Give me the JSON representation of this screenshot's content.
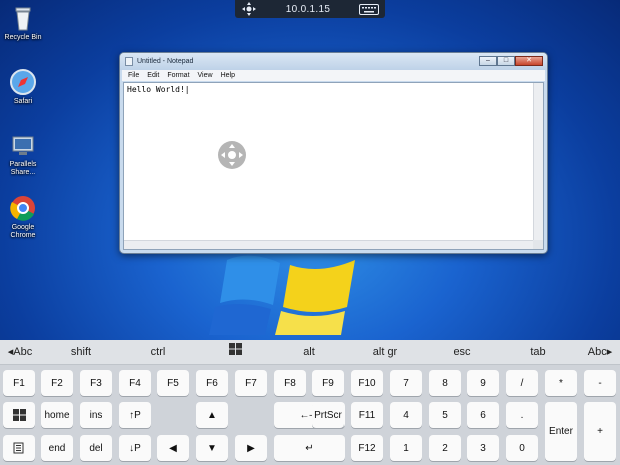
{
  "remote_bar": {
    "address": "10.0.1.15"
  },
  "desktop_icons": [
    {
      "label": "Recycle Bin",
      "icon": "recycle-bin-icon"
    },
    {
      "label": "Safari",
      "icon": "safari-icon"
    },
    {
      "label": "Parallels Share...",
      "icon": "parallels-share-icon"
    },
    {
      "label": "Google Chrome",
      "icon": "chrome-icon"
    }
  ],
  "notepad": {
    "title": "Untitled - Notepad",
    "menu": [
      "File",
      "Edit",
      "Format",
      "View",
      "Help"
    ],
    "content": "Hello World!|"
  },
  "keyboard": {
    "modifiers": [
      "◂Abc",
      "shift",
      "ctrl",
      "win",
      "alt",
      "alt gr",
      "esc",
      "tab",
      "Abc▸"
    ],
    "row1": [
      "F1",
      "F2",
      "F3",
      "F4",
      "F5",
      "F6",
      "F7",
      "F8",
      "F9",
      "F10",
      "7",
      "8",
      "9",
      "/",
      "*",
      "-"
    ],
    "row2": [
      "win",
      "home",
      "ins",
      "↑P",
      "▲",
      "←—",
      "PrtScr",
      "F11",
      "4",
      "5",
      "6",
      ".",
      "+"
    ],
    "row3": [
      "menu",
      "end",
      "del",
      "↓P",
      "◀",
      "▼",
      "▶",
      "↵",
      "F12",
      "1",
      "2",
      "3",
      "0",
      "Enter"
    ]
  }
}
